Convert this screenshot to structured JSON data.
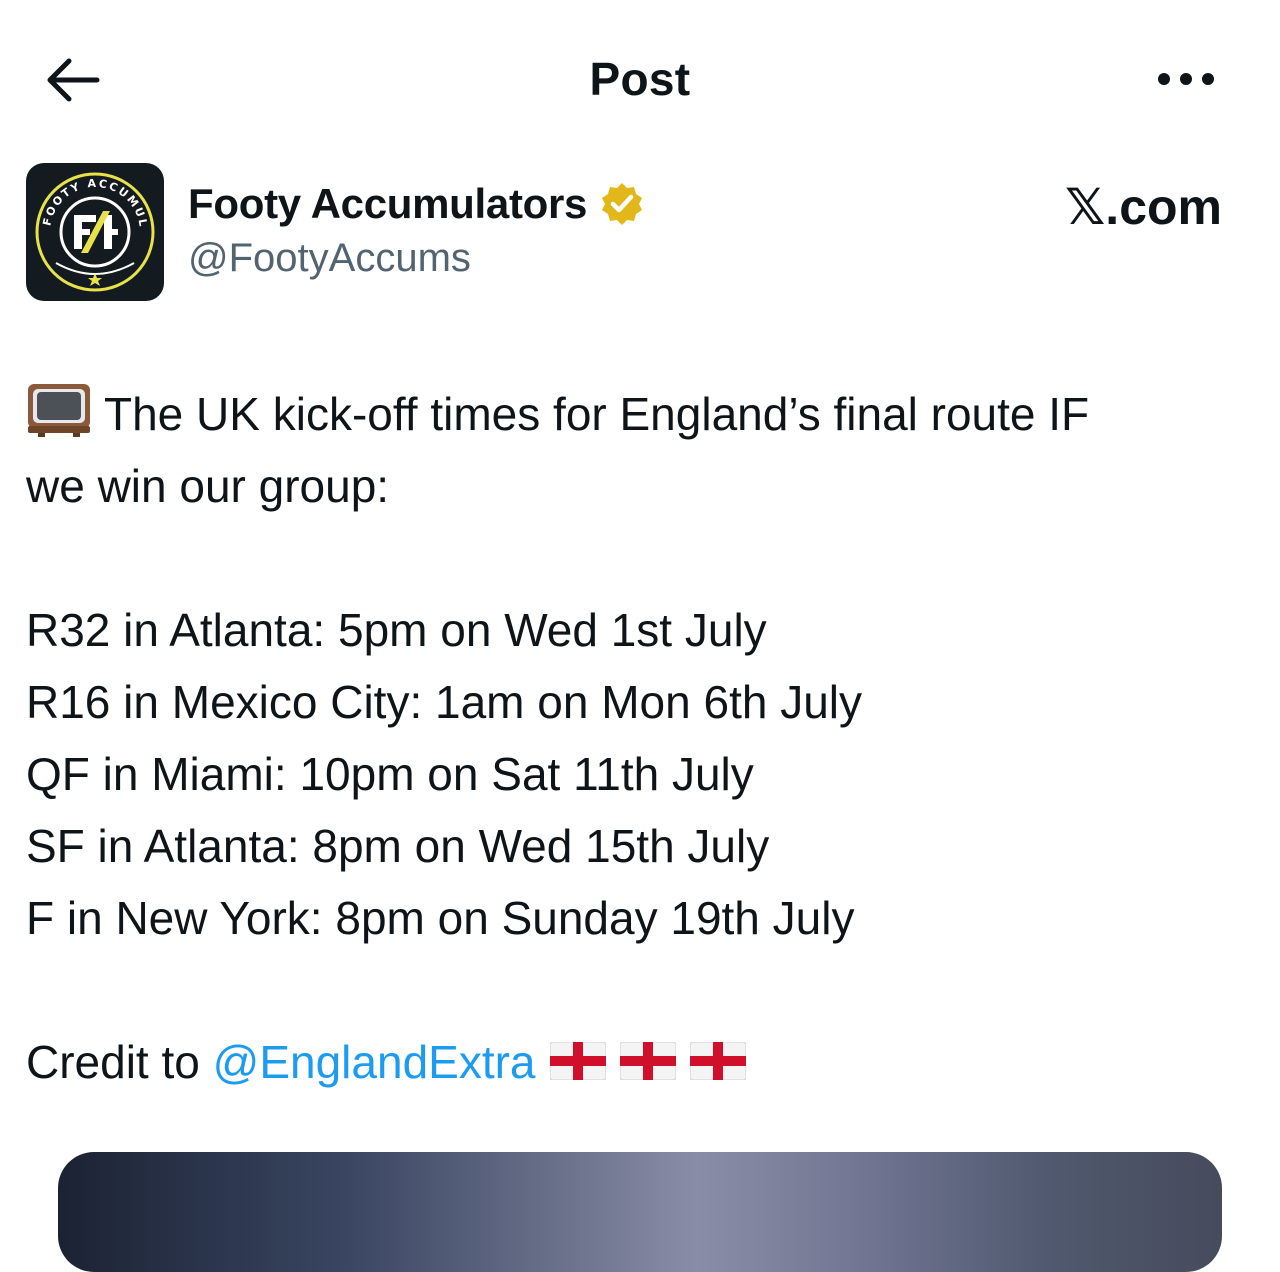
{
  "header": {
    "title": "Post"
  },
  "author": {
    "name": "Footy Accumulators",
    "handle": "@FootyAccums",
    "verified": true,
    "avatar_label": "FOOTY ACCUMULATORS",
    "avatar_initials": "FA"
  },
  "source": {
    "label": ".com",
    "mark": "𝕏"
  },
  "post": {
    "intro_line1": "The UK kick-off times for England’s final route IF",
    "intro_line2": "we win our group:",
    "fixtures": [
      "R32 in Atlanta: 5pm on Wed 1st July",
      "R16 in Mexico City: 1am on Mon 6th July",
      "QF in Miami: 10pm on Sat 11th July",
      "SF in Atlanta: 8pm on Wed 15th July",
      "F in New York: 8pm on Sunday 19th July"
    ],
    "credit_prefix": "Credit to ",
    "credit_mention": "@EnglandExtra"
  },
  "colors": {
    "accent": "#1d9bf0",
    "text": "#0f1419",
    "secondary_text": "#536471",
    "verified_badge": "#e2b719",
    "avatar_bg": "#131a20",
    "avatar_yellow": "#e8e24a"
  },
  "icons": {
    "back": "back-arrow-icon",
    "more": "more-dots-icon",
    "verified": "verified-badge-icon",
    "tv": "television-icon",
    "flag": "england-flag-icon"
  }
}
